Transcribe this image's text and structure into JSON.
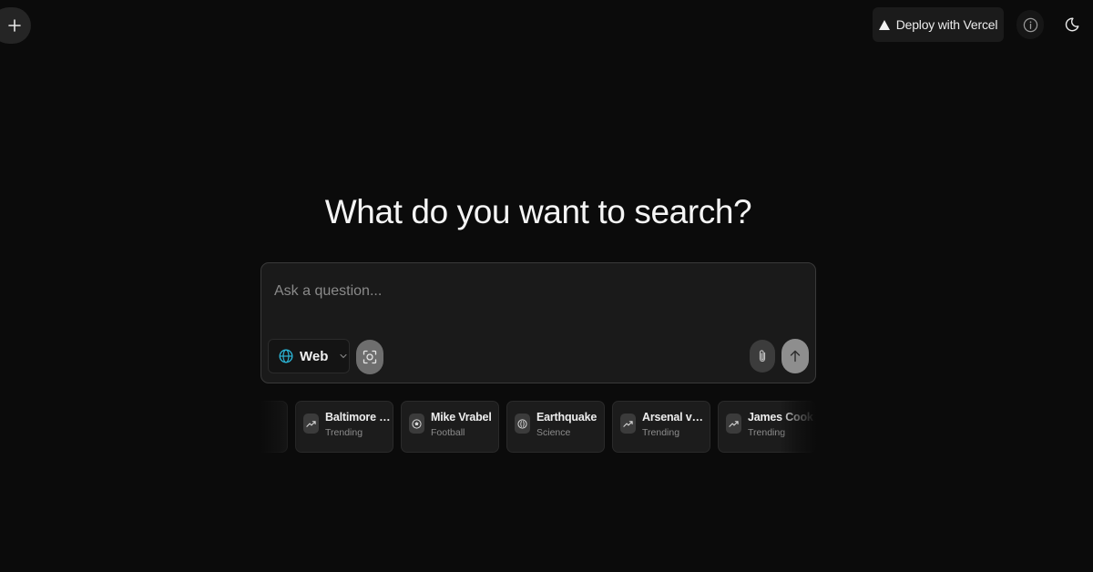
{
  "header": {
    "new_chat_icon": "plus-icon",
    "deploy_label": "Deploy with Vercel",
    "deploy_icon": "vercel-triangle-icon",
    "info_icon": "info-icon",
    "theme_icon": "moon-icon"
  },
  "main": {
    "title": "What do you want to search?",
    "search": {
      "placeholder": "Ask a question...",
      "value": "",
      "mode_label": "Web",
      "mode_icon": "globe-icon",
      "accent_color": "#2bb3d4"
    }
  },
  "suggestions": [
    {
      "name": "",
      "category": "",
      "icon": "trending-icon"
    },
    {
      "name": "Baltimore Ravens",
      "category": "Trending",
      "icon": "trending-icon"
    },
    {
      "name": "Mike Vrabel",
      "category": "Football",
      "icon": "football-icon"
    },
    {
      "name": "Earthquake",
      "category": "Science",
      "icon": "science-icon"
    },
    {
      "name": "Arsenal vs ...",
      "category": "Trending",
      "icon": "trending-icon"
    },
    {
      "name": "James Cook",
      "category": "Trending",
      "icon": "trending-icon"
    }
  ]
}
